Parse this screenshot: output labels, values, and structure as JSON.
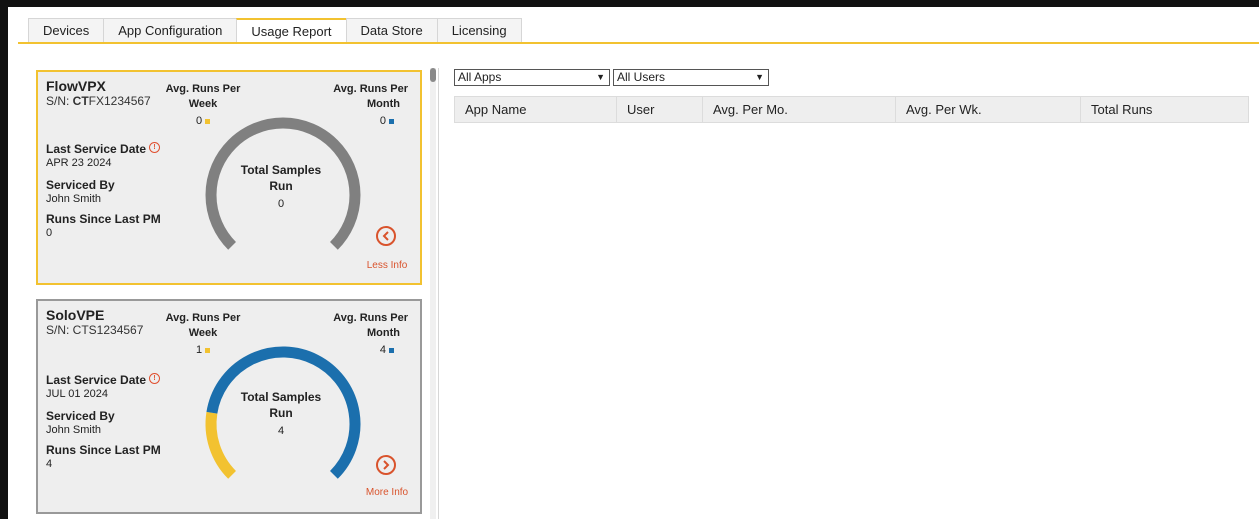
{
  "tabs": [
    {
      "label": "Devices"
    },
    {
      "label": "App Configuration"
    },
    {
      "label": "Usage Report"
    },
    {
      "label": "Data Store"
    },
    {
      "label": "Licensing"
    }
  ],
  "active_tab": "Usage Report",
  "colors": {
    "accent": "#f2c230",
    "blue": "#1b6fad",
    "gauge_empty": "#808080",
    "action": "#d9532c"
  },
  "devices": [
    {
      "model": "FlowVPX",
      "serial_prefix": "S/N: ",
      "serial_bold": "CT",
      "serial_rest": "FX1234567",
      "avg_week_label": "Avg. Runs Per Week",
      "avg_week_label_1": "Avg. Runs Per",
      "avg_week_label_2": "Week",
      "avg_week_value": "0",
      "avg_month_label_1": "Avg. Runs Per",
      "avg_month_label_2": "Month",
      "avg_month_value": "0",
      "last_service_label": "Last Service Date",
      "last_service_value": "APR 23 2024",
      "serviced_by_label": "Serviced By",
      "serviced_by_value": "John Smith",
      "runs_since_label": "Runs Since Last PM",
      "runs_since_value": "0",
      "total_label_1": "Total Samples",
      "total_label_2": "Run",
      "total_value": "0",
      "toggle_label": "Less Info",
      "toggle_icon": "chevron-left-icon",
      "selected": true,
      "gauge_fraction_yellow": 0,
      "gauge_fraction_blue": 0
    },
    {
      "model": "SoloVPE",
      "serial_prefix": "S/N: ",
      "serial_bold": "",
      "serial_rest": "CTS1234567",
      "avg_week_label_1": "Avg. Runs Per",
      "avg_week_label_2": "Week",
      "avg_week_value": "1",
      "avg_month_label_1": "Avg. Runs Per",
      "avg_month_label_2": "Month",
      "avg_month_value": "4",
      "last_service_label": "Last Service Date",
      "last_service_value": "JUL 01 2024",
      "serviced_by_label": "Serviced By",
      "serviced_by_value": "John Smith",
      "runs_since_label": "Runs Since Last PM",
      "runs_since_value": "4",
      "total_label_1": "Total Samples",
      "total_label_2": "Run",
      "total_value": "4",
      "toggle_label": "More Info",
      "toggle_icon": "chevron-right-icon",
      "selected": false,
      "gauge_fraction_yellow": 0.2,
      "gauge_fraction_blue": 0.8
    }
  ],
  "filters": {
    "apps": "All Apps",
    "users": "All Users"
  },
  "report_table": {
    "columns": [
      "App Name",
      "User",
      "Avg. Per Mo.",
      "Avg. Per Wk.",
      "Total Runs"
    ],
    "rows": []
  }
}
